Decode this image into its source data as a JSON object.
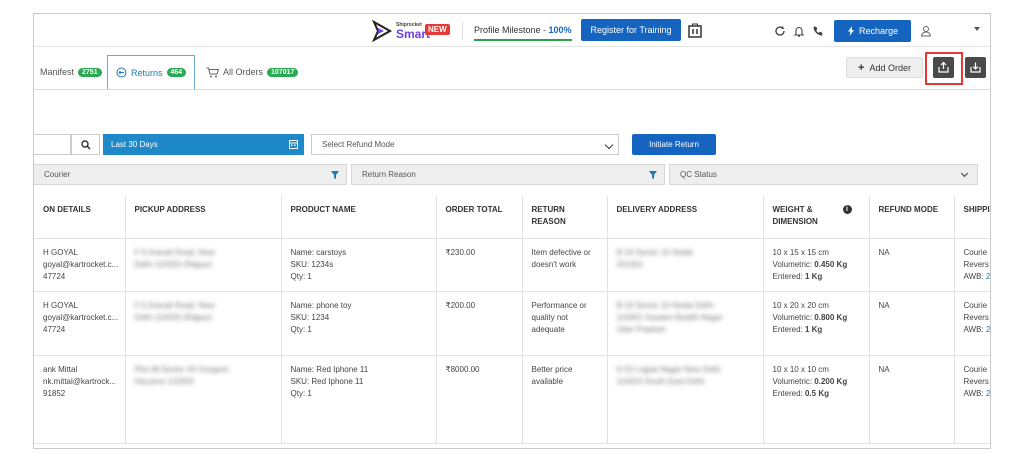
{
  "topbar": {
    "logo_small": "Shiprocket",
    "logo_big": "Smart",
    "new_badge": "NEW",
    "milestone_label": "Profile Milestone - ",
    "milestone_value": "100%",
    "training_button": "Register for Training",
    "recharge_button": "Recharge"
  },
  "tabs": [
    {
      "label": "Manifest",
      "count": "2751"
    },
    {
      "label": "Returns",
      "count": "464"
    },
    {
      "label": "All Orders",
      "count": "107017"
    }
  ],
  "actions": {
    "add_order": "Add Order"
  },
  "filters": {
    "date_range": "Last 30 Days",
    "refund_mode_placeholder": "Select Refund Mode",
    "initiate_return": "Initiate Return",
    "courier": "Courier",
    "return_reason": "Return Reason",
    "qc_status": "QC Status"
  },
  "colors": {
    "primary": "#1565c0",
    "badge_green": "#2aa853",
    "highlight": "#e53935"
  },
  "table": {
    "headers": [
      "ON DETAILS",
      "PICKUP ADDRESS",
      "PRODUCT NAME",
      "ORDER TOTAL",
      "RETURN REASON",
      "DELIVERY ADDRESS",
      "WEIGHT & DIMENSION",
      "REFUND MODE",
      "SHIPPI"
    ],
    "rows": [
      {
        "name": "H GOYAL",
        "email": "goyal@kartrocket.c...",
        "phone": "47724",
        "pickup_l1": "F-5 Aravali Road, New",
        "pickup_l2": "Delhi 110020 (Rajpur)",
        "product": "Name: carstoys",
        "sku": "SKU: 1234s",
        "qty": "Qty: 1",
        "total": "₹230.00",
        "reason_l1": "Item defective or",
        "reason_l2": "doesn't work",
        "reason_l3": "",
        "delivery_l1": "B-19 Sector 10 Noida",
        "delivery_l2": "201301",
        "delivery_l3": "",
        "dim": "10 x 15 x 15 cm",
        "vol_label": "Volumetric: ",
        "vol": "0.450 Kg",
        "ent_label": "Entered: ",
        "ent": "1 Kg",
        "refund": "NA",
        "ship1": "Courie",
        "ship2": "Revers",
        "ship3": "AWB: ",
        "awb": "2"
      },
      {
        "name": "H GOYAL",
        "email": "goyal@kartrocket.c...",
        "phone": "47724",
        "pickup_l1": "F-5 Aravali Road, New",
        "pickup_l2": "Delhi 110020 (Rajpur)",
        "product": "Name: phone toy",
        "sku": "SKU: 1234",
        "qty": "Qty: 1",
        "total": "₹200.00",
        "reason_l1": "Performance or",
        "reason_l2": "quality not",
        "reason_l3": "adequate",
        "delivery_l1": "B-19 Sector 10 Noida Delhi",
        "delivery_l2": "110001 Gautam Buddh Nagar",
        "delivery_l3": "Uttar Pradesh",
        "dim": "10 x 20 x 20 cm",
        "vol_label": "Volumetric: ",
        "vol": "0.800 Kg",
        "ent_label": "Entered: ",
        "ent": "1 Kg",
        "refund": "NA",
        "ship1": "Courie",
        "ship2": "Revers",
        "ship3": "AWB: ",
        "awb": "2"
      },
      {
        "name": "ank Mittal",
        "email": "nk.mittal@kartrock...",
        "phone": "91852",
        "pickup_l1": "Plot 48 Sector 44 Gurgaon",
        "pickup_l2": "Haryana 122003",
        "product": "Name: Red Iphone 11",
        "sku": "SKU: Red Iphone 11",
        "qty": "Qty: 1",
        "total": "₹8000.00",
        "reason_l1": "Better price",
        "reason_l2": "available",
        "reason_l3": "",
        "delivery_l1": "H-52 Lajpat Nagar New Delhi",
        "delivery_l2": "110024 South East Delhi",
        "delivery_l3": "",
        "dim": "10 x 10 x 10 cm",
        "vol_label": "Volumetric: ",
        "vol": "0.200 Kg",
        "ent_label": "Entered: ",
        "ent": "0.5 Kg",
        "refund": "NA",
        "ship1": "Courie",
        "ship2": "Revers",
        "ship3": "AWB: ",
        "awb": "2"
      }
    ]
  }
}
